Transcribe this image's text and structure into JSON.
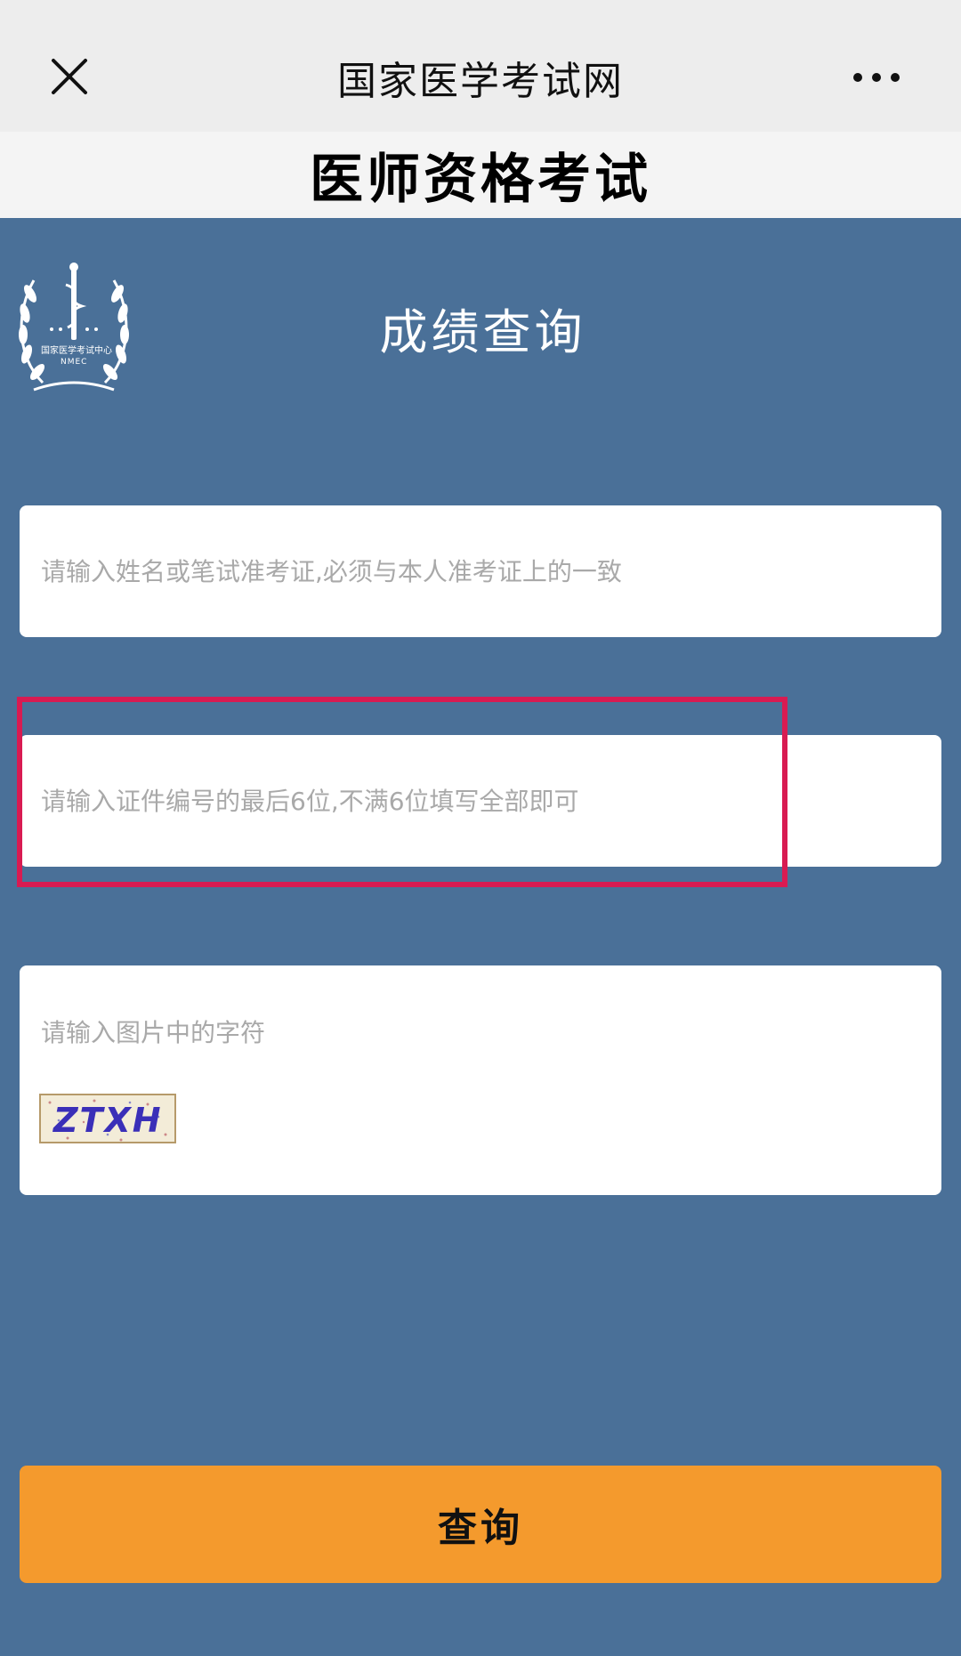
{
  "nav": {
    "title": "国家医学考试网",
    "close_icon": "close-icon",
    "more_icon": "more-icon"
  },
  "header": {
    "title": "医师资格考试"
  },
  "logo": {
    "text_cn": "国家医学考试中心",
    "text_en": "NMEC"
  },
  "page": {
    "heading": "成绩查询"
  },
  "form": {
    "name_placeholder": "请输入姓名或笔试准考证,必须与本人准考证上的一致",
    "id_placeholder": "请输入证件编号的最后6位,不满6位填写全部即可",
    "captcha_placeholder": "请输入图片中的字符",
    "captcha_text": "ZTXH",
    "name_value": "",
    "id_value": "",
    "captcha_value": ""
  },
  "submit": {
    "label": "查询"
  },
  "colors": {
    "background": "#4a7098",
    "button": "#f49a2d",
    "highlight": "#d81b52"
  }
}
